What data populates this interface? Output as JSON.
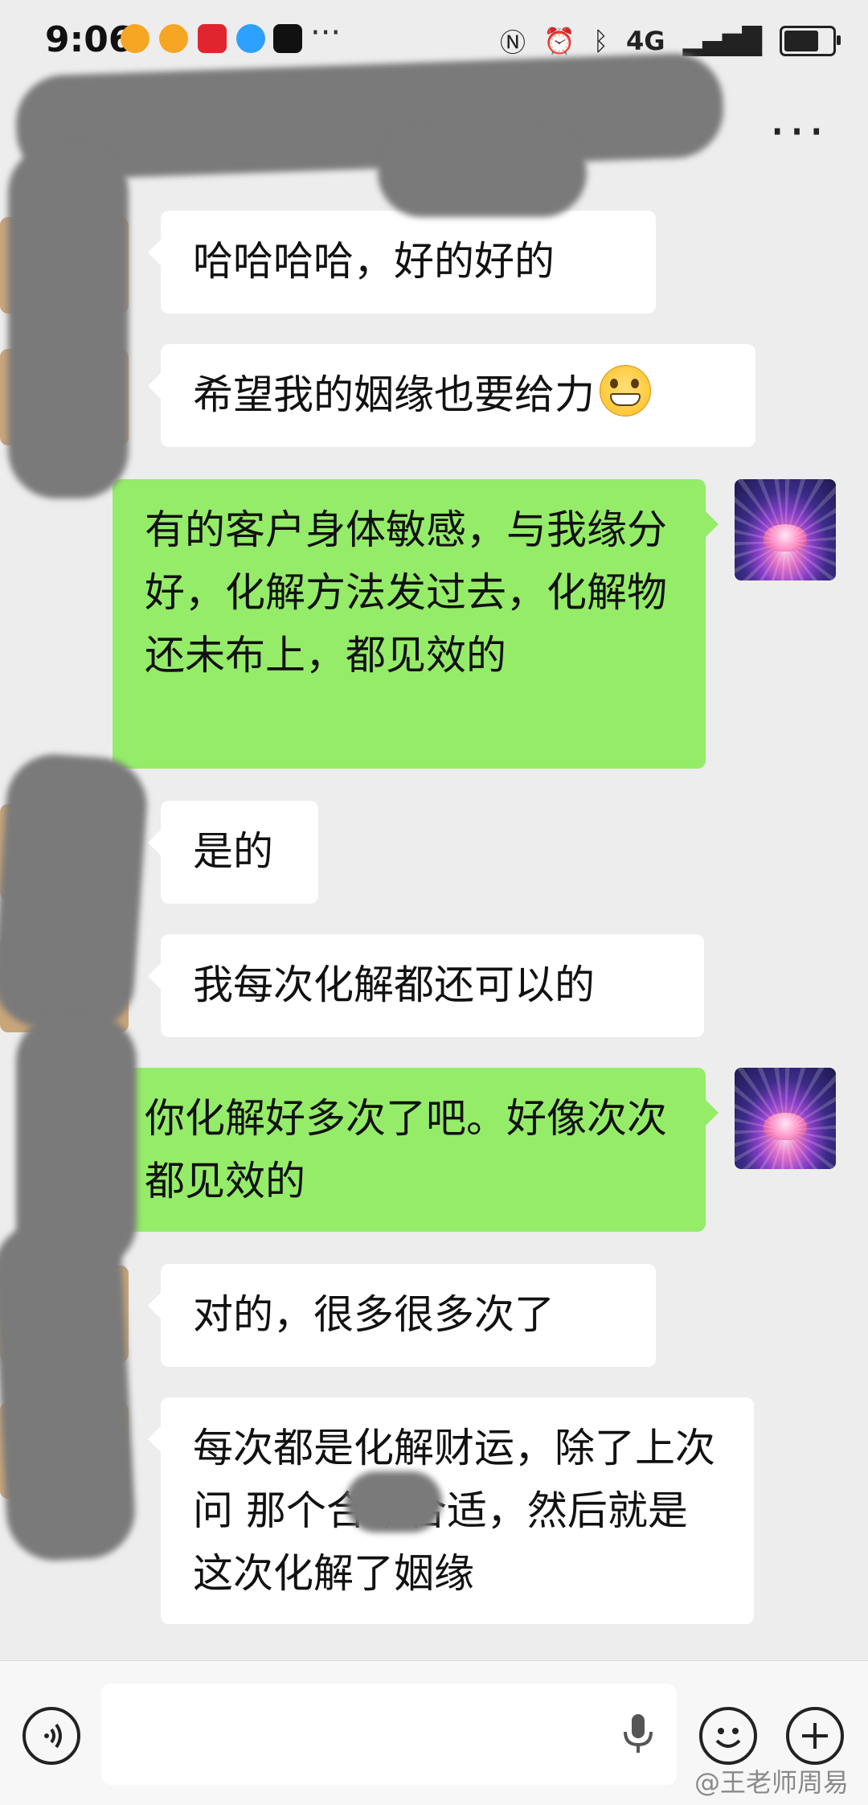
{
  "status_bar": {
    "time": "9:06",
    "more": "···",
    "network": "4G",
    "battery_level": 0.8
  },
  "header": {
    "more": "···"
  },
  "messages": [
    {
      "side": "in",
      "text": "哈哈哈哈，好的好的"
    },
    {
      "side": "in",
      "text": "希望我的姻缘也要给力"
    },
    {
      "side": "out",
      "text": "有的客户身体敏感，与我缘分好，化解方法发过去，化解物还未布上，都见效的"
    },
    {
      "side": "in",
      "text": "是的"
    },
    {
      "side": "in",
      "text": "我每次化解都还可以的"
    },
    {
      "side": "out",
      "text": "你化解好多次了吧。好像次次都见效的"
    },
    {
      "side": "in",
      "text": "对的，很多很多次了"
    },
    {
      "side": "in",
      "text": "每次都是化解财运，除了上次问 那个合不合适，然后就是这次化解了姻缘"
    }
  ],
  "input": {
    "placeholder": ""
  },
  "watermark": "@王老师周易",
  "colors": {
    "background": "#ededed",
    "incoming_bubble": "#ffffff",
    "outgoing_bubble": "#95ec69",
    "redaction": "#7a7a7a"
  }
}
